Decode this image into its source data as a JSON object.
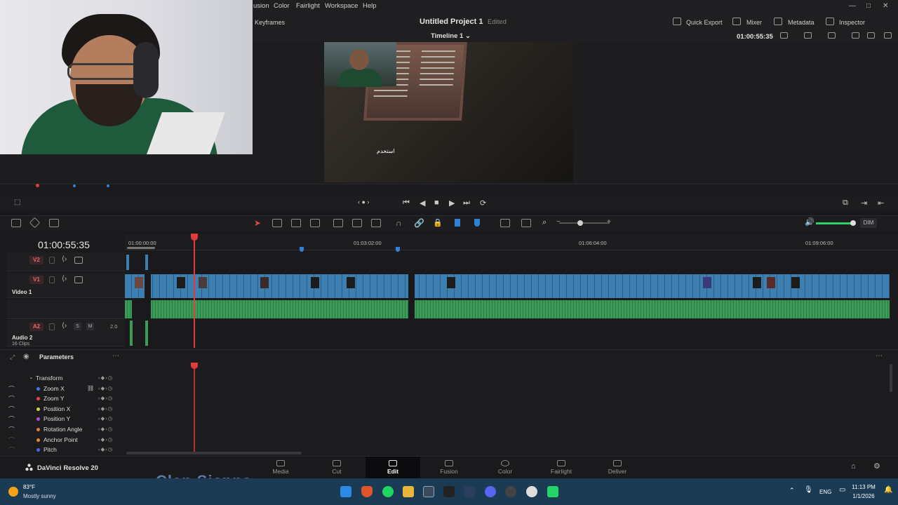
{
  "menu": {
    "items": [
      "usion",
      "Color",
      "Fairlight",
      "Workspace",
      "Help"
    ]
  },
  "header": {
    "keyframes_label": "Keyframes",
    "project_title": "Untitled Project 1",
    "edited_label": "Edited",
    "quick_export": "Quick Export",
    "mixer": "Mixer",
    "metadata": "Metadata",
    "inspector": "Inspector"
  },
  "viewer": {
    "timeline_name": "Timeline 1",
    "timecode": "01:00:55:35",
    "subtitle": "استخدم"
  },
  "timeline": {
    "timecode": "01:00:55:35",
    "ruler": [
      "01:00:00:00",
      "01:03:02:00",
      "01:06:04:00",
      "01:09:06:00"
    ],
    "tracks": {
      "v2": {
        "tag": "V2"
      },
      "v1": {
        "tag": "V1",
        "name": "Video 1"
      },
      "a2": {
        "tag": "A2",
        "name": "Audio 2",
        "clips": "16 Clips",
        "level": "2.0",
        "solo": "S",
        "mute": "M"
      }
    },
    "dim": "DIM"
  },
  "parameters": {
    "title": "Parameters",
    "group": "Transform",
    "rows": [
      {
        "label": "Zoom X",
        "color": "#3a7de0"
      },
      {
        "label": "Zoom Y",
        "color": "#e04848"
      },
      {
        "label": "Position X",
        "color": "#d6d04a"
      },
      {
        "label": "Position Y",
        "color": "#b24ad6"
      },
      {
        "label": "Rotation Angle",
        "color": "#e07a3a"
      },
      {
        "label": "Anchor Point",
        "color": "#e08a2a"
      },
      {
        "label": "Pitch",
        "color": "#4a6ae0"
      }
    ]
  },
  "pages": {
    "app_name": "DaVinci Resolve 20",
    "tabs": [
      "Media",
      "Cut",
      "Edit",
      "Fusion",
      "Color",
      "Fairlight",
      "Deliver"
    ],
    "active": "Edit"
  },
  "taskbar": {
    "temp": "83°F",
    "weather": "Mostly sunny",
    "lang": "ENG",
    "time": "11:13 PM",
    "date": "1/1/2026",
    "behind_text": "Clan Sienna"
  }
}
